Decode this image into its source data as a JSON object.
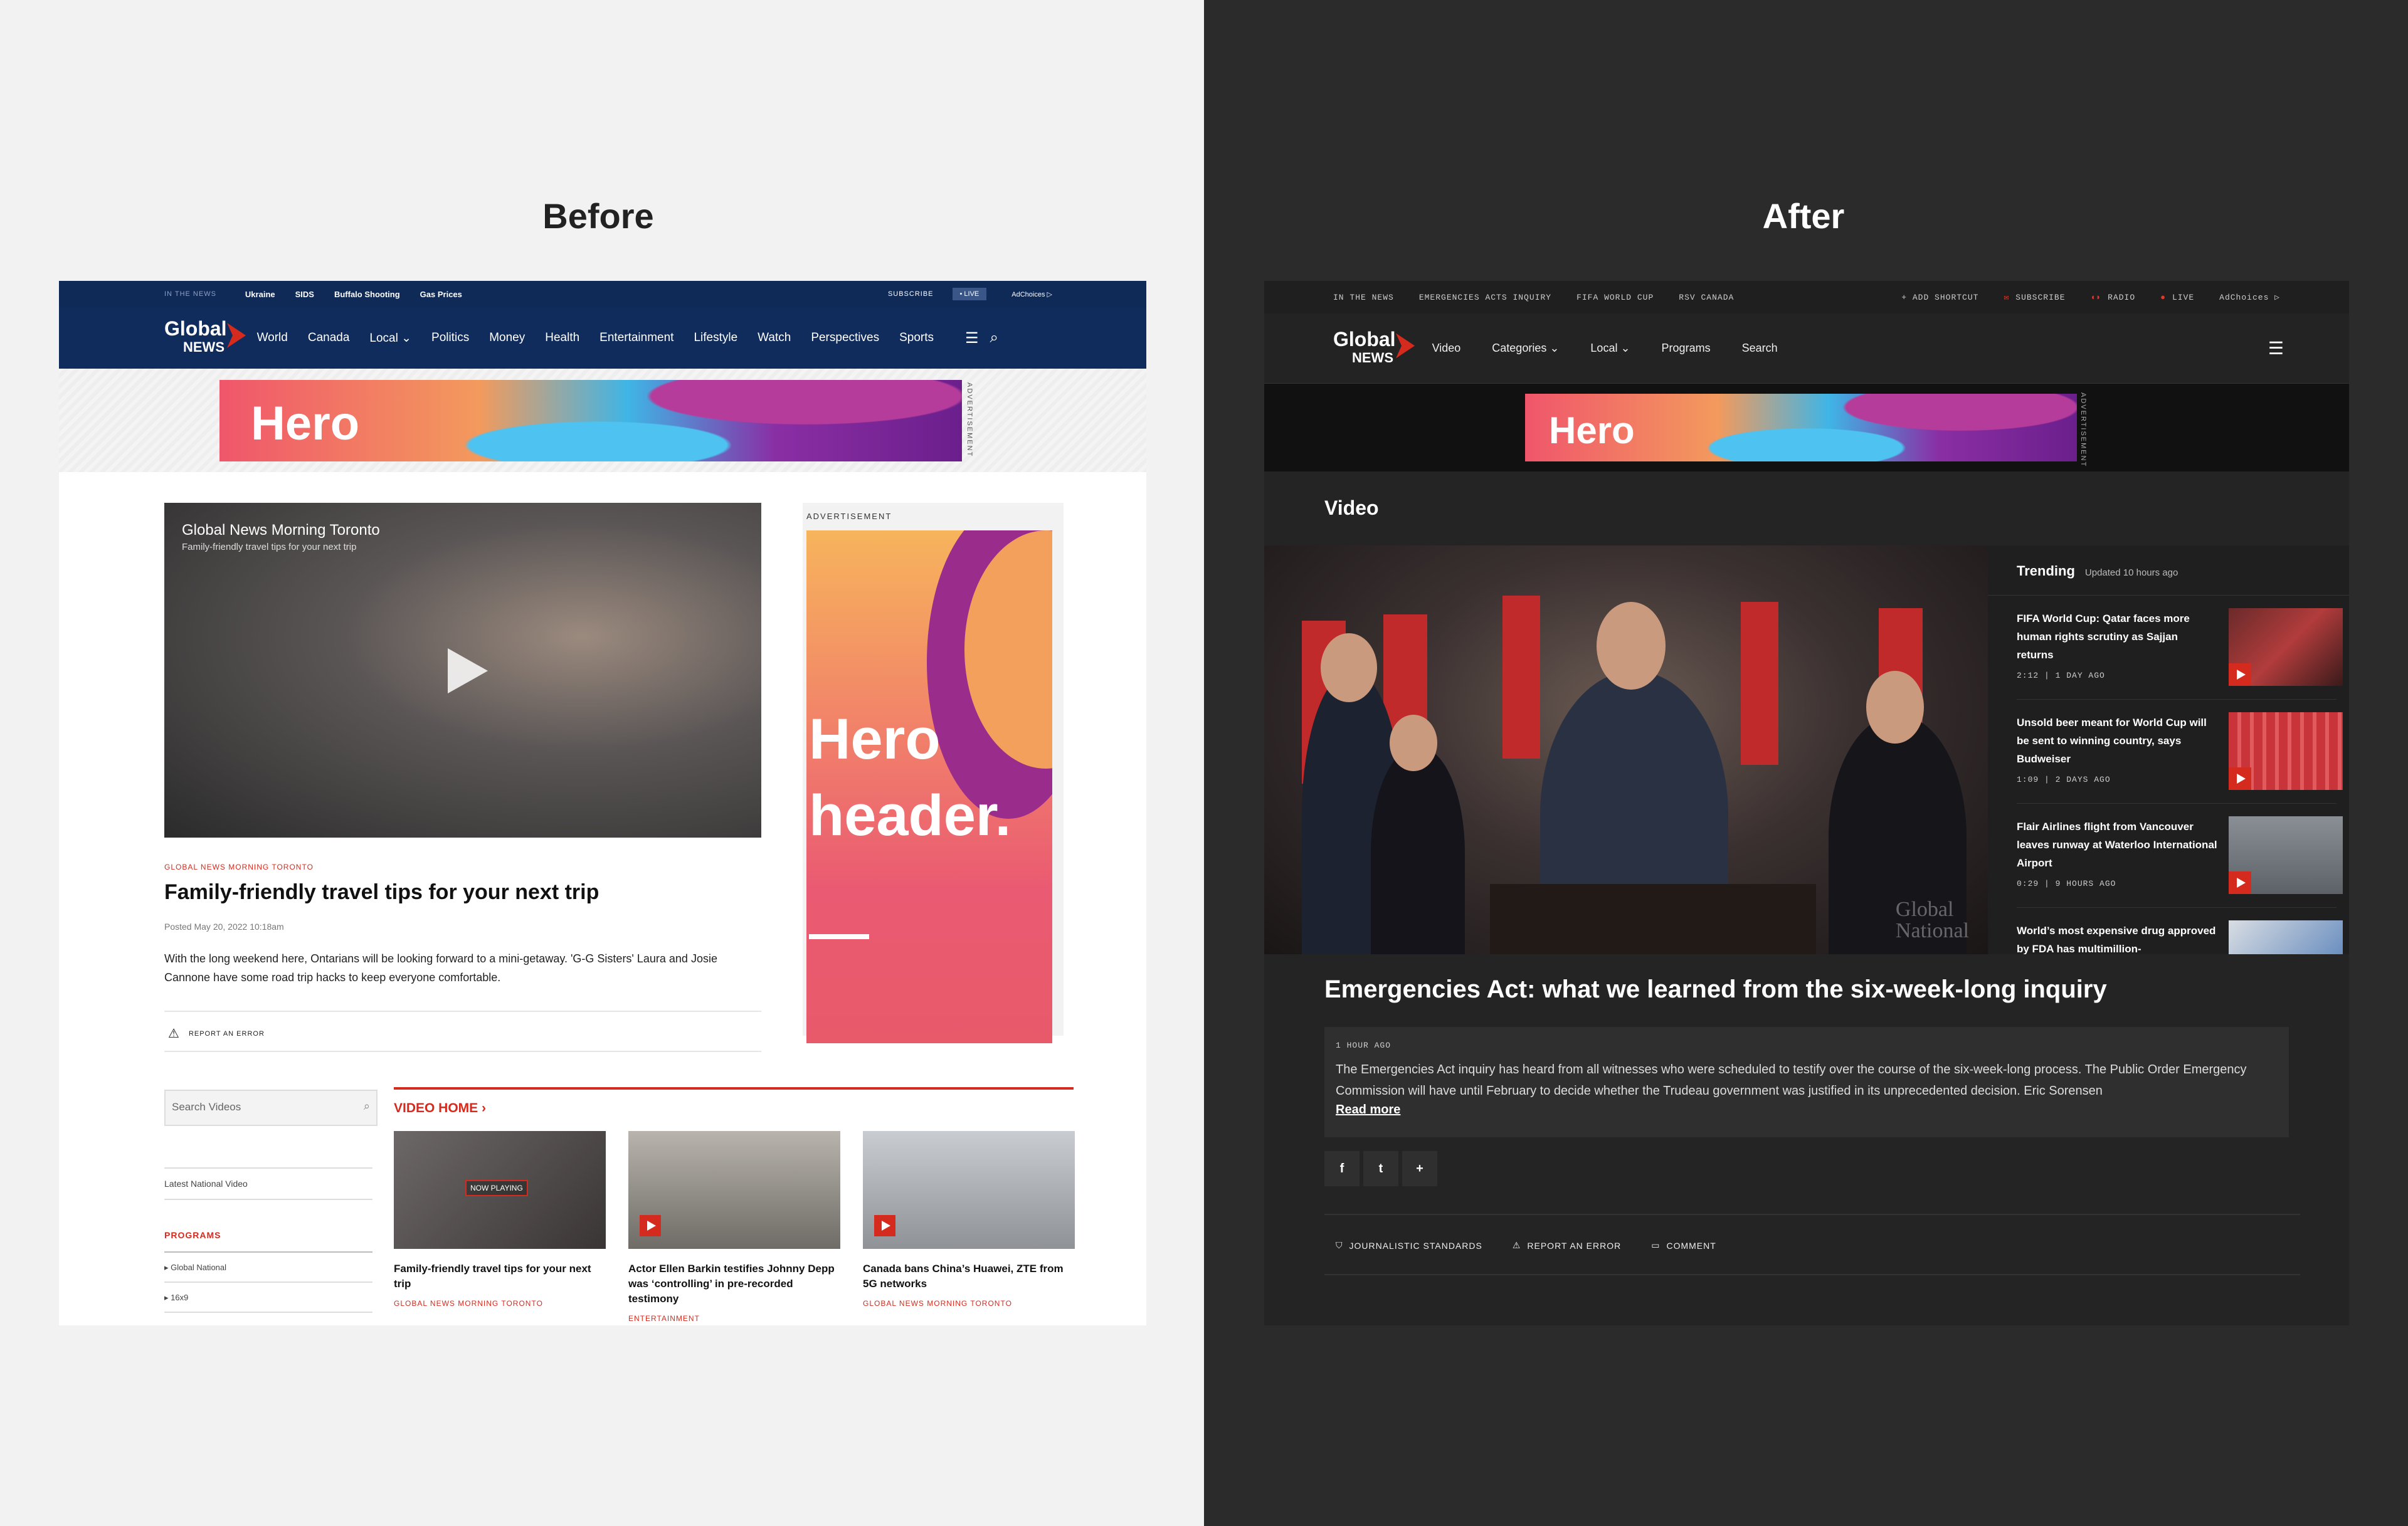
{
  "before_label": "Before",
  "after_label": "After",
  "before": {
    "topbar": {
      "label": "IN THE NEWS",
      "links": [
        "Ukraine",
        "SIDS",
        "Buffalo Shooting",
        "Gas Prices"
      ],
      "subscribe": "SUBSCRIBE",
      "live": "• LIVE",
      "adchoices": "AdChoices ▷"
    },
    "logo": {
      "top": "Global",
      "bottom": "NEWS"
    },
    "nav": [
      "World",
      "Canada",
      "Local ⌄",
      "Politics",
      "Money",
      "Health",
      "Entertainment",
      "Lifestyle",
      "Watch",
      "Perspectives",
      "Sports"
    ],
    "ad": {
      "text": "Hero",
      "label": "ADVERTISEMENT"
    },
    "video": {
      "title": "Global News Morning Toronto",
      "subtitle": "Family-friendly travel tips for your next trip"
    },
    "article": {
      "kicker": "GLOBAL NEWS MORNING TORONTO",
      "title": "Family-friendly travel tips for your next trip",
      "date": "Posted May 20, 2022 10:18am",
      "body": "With the long weekend here, Ontarians will be looking forward to a mini-getaway. 'G-G Sisters' Laura and Josie Cannone have some road trip hacks to keep everyone comfortable.",
      "report": "REPORT AN ERROR"
    },
    "side_ad": {
      "label": "ADVERTISEMENT",
      "line1": "Hero",
      "line2": "header."
    },
    "search_placeholder": "Search Videos",
    "latest": "Latest National Video",
    "programs": "PROGRAMS",
    "program_items": [
      "Global National",
      "16x9"
    ],
    "video_home": "VIDEO HOME ›",
    "cards": [
      {
        "caption": "Family-friendly travel tips for your next trip",
        "kicker": "GLOBAL NEWS MORNING TORONTO",
        "badge": "NOW PLAYING"
      },
      {
        "caption": "Actor Ellen Barkin testifies Johnny Depp was ‘controlling’ in pre-recorded testimony",
        "kicker": "ENTERTAINMENT"
      },
      {
        "caption": "Canada bans China’s Huawei, ZTE from 5G networks",
        "kicker": "GLOBAL NEWS MORNING TORONTO"
      }
    ]
  },
  "after": {
    "topbar": {
      "label": "IN THE NEWS",
      "links": [
        "EMERGENCIES ACTS INQUIRY",
        "FIFA WORLD CUP",
        "RSV CANADA"
      ],
      "add_shortcut": "+ ADD SHORTCUT",
      "subscribe": "SUBSCRIBE",
      "radio": "RADIO",
      "live": "LIVE",
      "adchoices": "AdChoices ▷"
    },
    "logo": {
      "top": "Global",
      "bottom": "NEWS"
    },
    "nav": [
      "Video",
      "Categories ⌄",
      "Local ⌄",
      "Programs",
      "Search"
    ],
    "ad": {
      "text": "Hero",
      "label": "ADVERTISEMENT"
    },
    "section": "Video",
    "watermark": "Global\nNational",
    "trending": {
      "title": "Trending",
      "updated": "Updated 10 hours ago",
      "items": [
        {
          "title": "FIFA World Cup: Qatar faces more human rights scrutiny as Sajjan returns",
          "meta": "2:12 | 1 DAY AGO"
        },
        {
          "title": "Unsold beer meant for World Cup will be sent to winning country, says Budweiser",
          "meta": "1:09 | 2 DAYS AGO"
        },
        {
          "title": "Flair Airlines flight from Vancouver leaves runway at Waterloo International Airport",
          "meta": "0:29 | 9 HOURS AGO"
        },
        {
          "title": "World’s most expensive drug approved by FDA has multimillion-",
          "meta": ""
        }
      ]
    },
    "title": "Emergencies Act: what we learned from the six-week-long inquiry",
    "time": "1 HOUR AGO",
    "description": "The Emergencies Act inquiry has heard from all witnesses who were scheduled to testify over the course of the six-week-long process. The Public Order Emergency Commission will have until February to decide whether the Trudeau government was justified in its unprecedented decision. Eric Sorensen",
    "read_more": "Read more",
    "share": [
      "f",
      "t",
      "+"
    ],
    "footer": [
      "JOURNALISTIC STANDARDS",
      "REPORT AN ERROR",
      "COMMENT"
    ]
  }
}
